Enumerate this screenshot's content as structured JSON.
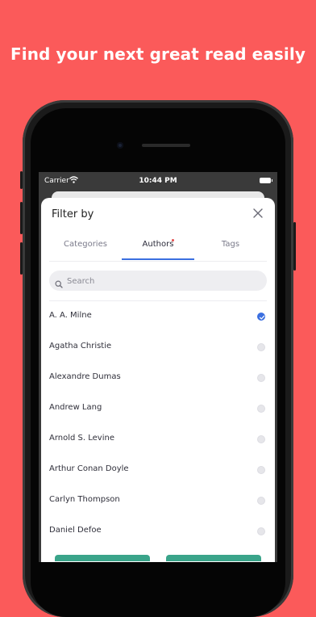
{
  "headline": "Find your next great read easily",
  "status_bar": {
    "carrier": "Carrier",
    "time": "10:44 PM"
  },
  "sheet": {
    "title": "Filter by",
    "tabs": [
      {
        "label": "Categories"
      },
      {
        "label": "Authors"
      },
      {
        "label": "Tags"
      }
    ],
    "active_tab": "Authors",
    "search": {
      "placeholder": "Search",
      "value": ""
    },
    "authors": [
      {
        "name": "A. A. Milne",
        "selected": true
      },
      {
        "name": "Agatha Christie",
        "selected": false
      },
      {
        "name": "Alexandre Dumas",
        "selected": false
      },
      {
        "name": "Andrew Lang",
        "selected": false
      },
      {
        "name": "Arnold S. Levine",
        "selected": false
      },
      {
        "name": "Arthur Conan Doyle",
        "selected": false
      },
      {
        "name": "Carlyn Thompson",
        "selected": false
      },
      {
        "name": "Daniel Defoe",
        "selected": false
      }
    ]
  },
  "colors": {
    "background": "#fb5a5a",
    "accent": "#3b6fe0",
    "tab_badge": "#e24b4b",
    "bottom_buttons": "#3aa48a"
  },
  "icons": {
    "close": "close-icon",
    "search": "search-icon",
    "checked": "checkmark-icon",
    "wifi": "wifi-icon",
    "battery": "battery-icon"
  }
}
